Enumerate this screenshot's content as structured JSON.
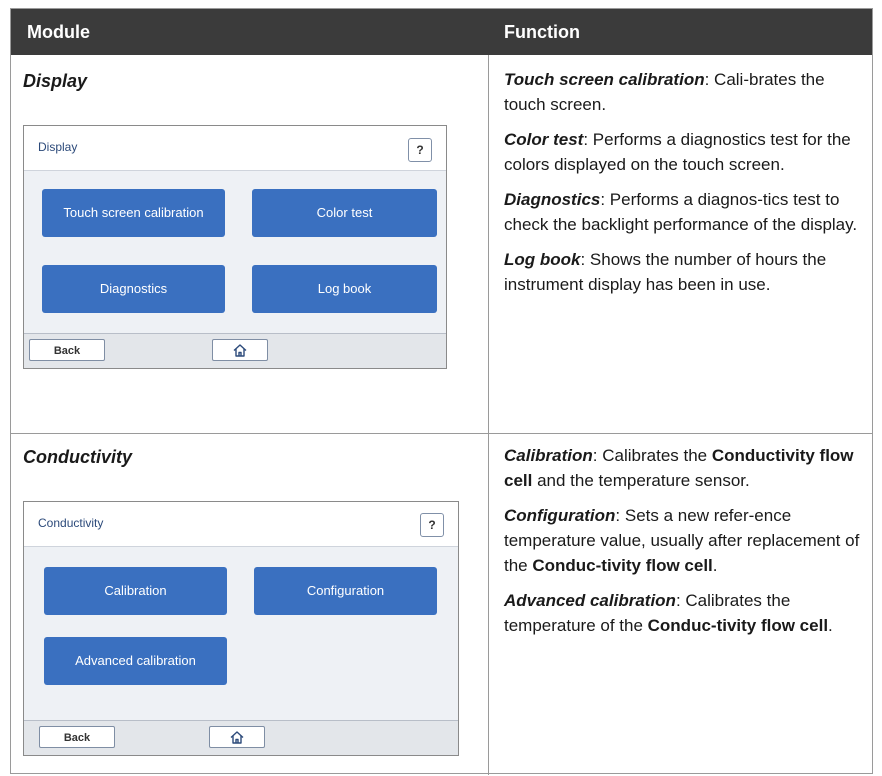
{
  "header": {
    "module": "Module",
    "function": "Function"
  },
  "rows": [
    {
      "module_title": "Display",
      "screen": {
        "title": "Display",
        "help": "?",
        "tiles": [
          "Touch screen calibration",
          "Color test",
          "Diagnostics",
          "Log book"
        ],
        "back": "Back",
        "home_icon": "home-icon"
      },
      "functions": [
        {
          "term": "Touch screen calibration",
          "text": ": Cali-brates the touch screen."
        },
        {
          "term": "Color test",
          "text": ": Performs a diagnostics test for the colors displayed on the touch screen."
        },
        {
          "term": "Diagnostics",
          "text": ": Performs a diagnos-tics test to check the backlight performance of the display."
        },
        {
          "term": "Log book",
          "text": ": Shows the number of hours the instrument display has been in use."
        }
      ]
    },
    {
      "module_title": "Conductivity",
      "screen": {
        "title": "Conductivity",
        "help": "?",
        "tiles": [
          "Calibration",
          "Configuration",
          "Advanced calibration"
        ],
        "back": "Back",
        "home_icon": "home-icon"
      },
      "functions": [
        {
          "term": "Calibration",
          "pre": ": Calibrates the ",
          "bold": "Conductivity flow cell",
          "post": " and the temperature sensor."
        },
        {
          "term": "Configuration",
          "pre": ": Sets a new refer-ence temperature value, usually after replacement of the ",
          "bold": "Conduc-tivity flow cell",
          "post": "."
        },
        {
          "term": "Advanced calibration",
          "pre": ": Calibrates the temperature of the ",
          "bold": "Conduc-tivity flow cell",
          "post": "."
        }
      ]
    }
  ]
}
